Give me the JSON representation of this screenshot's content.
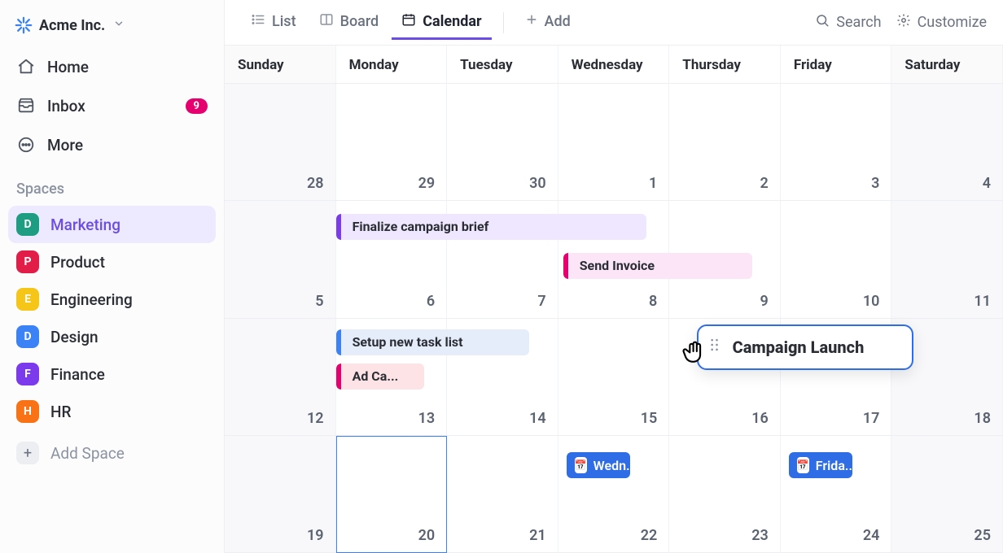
{
  "workspace": {
    "name": "Acme Inc."
  },
  "nav": {
    "home": "Home",
    "inbox": "Inbox",
    "inbox_badge": "9",
    "more": "More"
  },
  "spaces_section": "Spaces",
  "spaces": [
    {
      "letter": "D",
      "label": "Marketing",
      "color": "#1f9d83",
      "active": true
    },
    {
      "letter": "P",
      "label": "Product",
      "color": "#e11d48",
      "active": false
    },
    {
      "letter": "E",
      "label": "Engineering",
      "color": "#f5c518",
      "active": false
    },
    {
      "letter": "D",
      "label": "Design",
      "color": "#3b82f6",
      "active": false
    },
    {
      "letter": "F",
      "label": "Finance",
      "color": "#7c3aed",
      "active": false
    },
    {
      "letter": "H",
      "label": "HR",
      "color": "#f97316",
      "active": false
    }
  ],
  "add_space": "Add Space",
  "views": {
    "list": "List",
    "board": "Board",
    "calendar": "Calendar",
    "add": "Add"
  },
  "toolbar": {
    "search": "Search",
    "customize": "Customize"
  },
  "days": [
    "Sunday",
    "Monday",
    "Tuesday",
    "Wednesday",
    "Thursday",
    "Friday",
    "Saturday"
  ],
  "weeks": [
    [
      28,
      29,
      30,
      1,
      2,
      3,
      4
    ],
    [
      5,
      6,
      7,
      8,
      9,
      10,
      11
    ],
    [
      12,
      13,
      14,
      15,
      16,
      17,
      18
    ],
    [
      19,
      20,
      21,
      22,
      23,
      24,
      25
    ]
  ],
  "events": {
    "finalize": "Finalize campaign brief",
    "invoice": "Send Invoice",
    "setup": "Setup new task list",
    "adcamp": "Ad Ca...",
    "launch": "Campaign Launch",
    "wed": "Wedn...",
    "fri": "Frida..."
  },
  "colors": {
    "purple_bar": "#7c3aed",
    "purple_bg": "#efe7ff",
    "pink_bar": "#e6006f",
    "pink_bg": "#fbe5f7",
    "blue_bar": "#3b82f6",
    "blue_bg": "#e5edfb",
    "rose_bar": "#e6006f",
    "rose_bg": "#fde2e6"
  }
}
